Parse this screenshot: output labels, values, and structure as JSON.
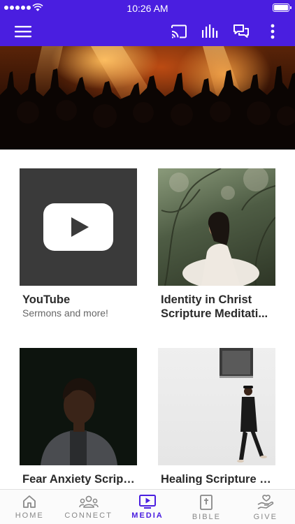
{
  "status_bar": {
    "time": "10:26 AM"
  },
  "app_bar": {
    "icons": [
      "menu-icon",
      "cast-icon",
      "audio-bars-icon",
      "chat-icon",
      "more-vertical-icon"
    ]
  },
  "colors": {
    "brand": "#4a1ee0",
    "tab_inactive": "#888888"
  },
  "media": {
    "cards": [
      {
        "title": "YouTube",
        "subtitle": "Sermons and more!"
      },
      {
        "title": "Identity in Christ Scripture Meditati...",
        "subtitle": ""
      },
      {
        "title": "Fear Anxiety Scripture Meditati...",
        "subtitle": ""
      },
      {
        "title": "Healing Scripture Meditati...",
        "subtitle": ""
      }
    ]
  },
  "tab_bar": {
    "active": "MEDIA",
    "tabs": [
      {
        "label": "HOME",
        "icon": "home-icon"
      },
      {
        "label": "CONNECT",
        "icon": "group-icon"
      },
      {
        "label": "MEDIA",
        "icon": "tv-play-icon"
      },
      {
        "label": "BIBLE",
        "icon": "bible-icon"
      },
      {
        "label": "GIVE",
        "icon": "give-hand-icon"
      }
    ]
  }
}
